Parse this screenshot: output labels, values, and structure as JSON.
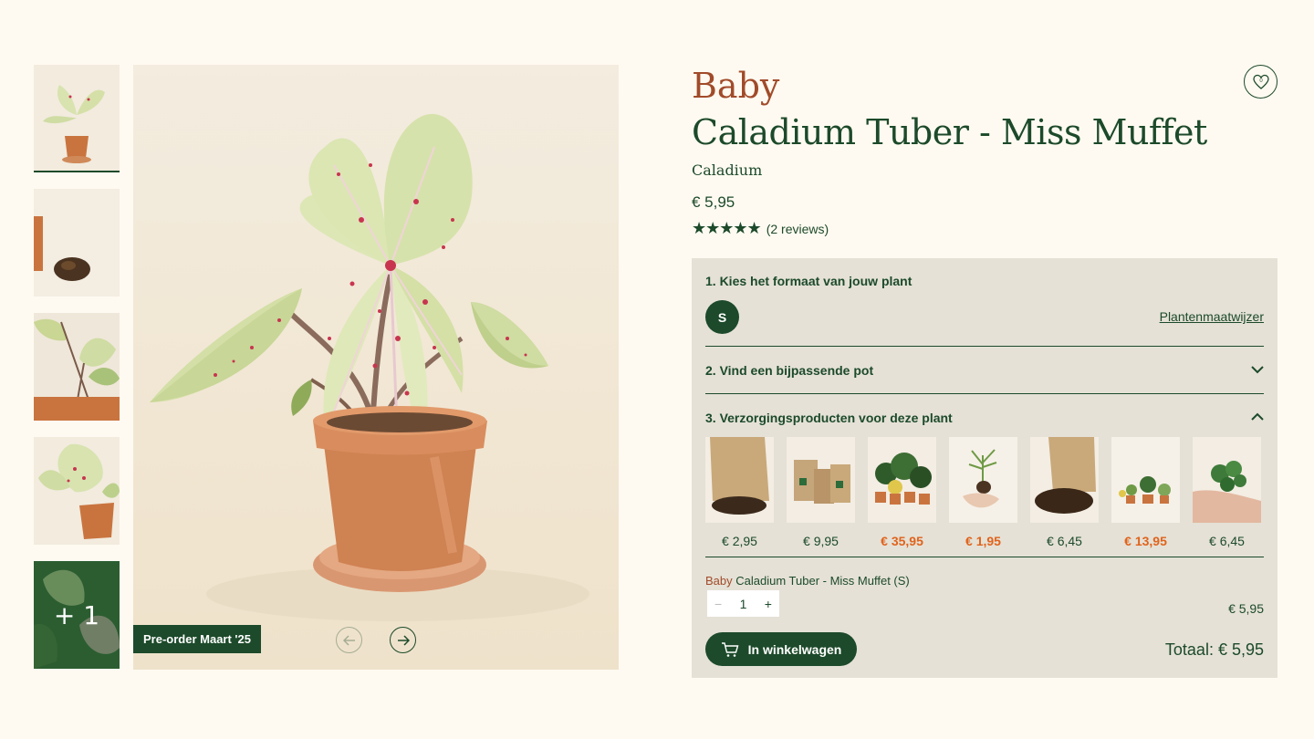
{
  "product": {
    "prefix": "Baby",
    "title": "Caladium Tuber - Miss Muffet",
    "latin": "Caladium",
    "price": "€ 5,95",
    "reviews": "(2 reviews)",
    "rating": 5
  },
  "gallery": {
    "more_label": "+ 1",
    "preorder": "Pre-order Maart '25"
  },
  "config": {
    "step1": "1. Kies het formaat van jouw plant",
    "size": "S",
    "size_guide": "Plantenmaatwijzer",
    "step2": "2. Vind een bijpassende pot",
    "step3": "3. Verzorgingsproducten voor deze plant",
    "products": [
      {
        "price": "€ 2,95",
        "sale": false
      },
      {
        "price": "€ 9,95",
        "sale": false
      },
      {
        "price": "€ 35,95",
        "sale": true
      },
      {
        "price": "€ 1,95",
        "sale": true
      },
      {
        "price": "€ 6,45",
        "sale": false
      },
      {
        "price": "€ 13,95",
        "sale": true
      },
      {
        "price": "€ 6,45",
        "sale": false
      }
    ]
  },
  "summary": {
    "prefix": "Baby",
    "name": "Caladium Tuber - Miss Muffet (S)",
    "qty": "1",
    "minus": "−",
    "plus": "+",
    "line_price": "€ 5,95",
    "cart_label": "In winkelwagen",
    "total": "Totaal:  € 5,95"
  },
  "colors": {
    "brand_green": "#1c4a2a",
    "accent_rust": "#a14b2a",
    "sale_orange": "#e0631c",
    "panel": "#e5e1d6",
    "background": "#fffaf1"
  }
}
